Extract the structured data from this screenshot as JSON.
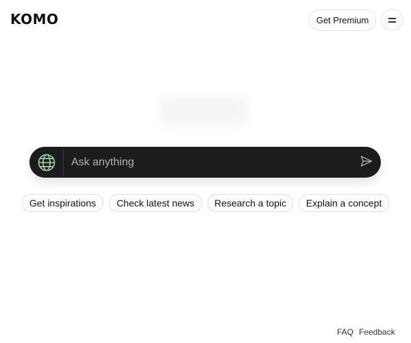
{
  "header": {
    "logo": "KOMO",
    "premium_label": "Get Premium",
    "menu_icon": "hamburger-menu-icon"
  },
  "search": {
    "placeholder": "Ask anything",
    "value": "",
    "globe_icon": "globe-icon",
    "send_icon": "send-icon",
    "globe_color": "#9fd8a1"
  },
  "suggestions": [
    {
      "label": "Get inspirations"
    },
    {
      "label": "Check latest news"
    },
    {
      "label": "Research a topic"
    },
    {
      "label": "Explain a concept"
    }
  ],
  "footer": {
    "faq": "FAQ",
    "feedback": "Feedback"
  },
  "colors": {
    "search_bg": "#1c1c1e",
    "page_bg": "#ffffff",
    "text": "#111111"
  }
}
